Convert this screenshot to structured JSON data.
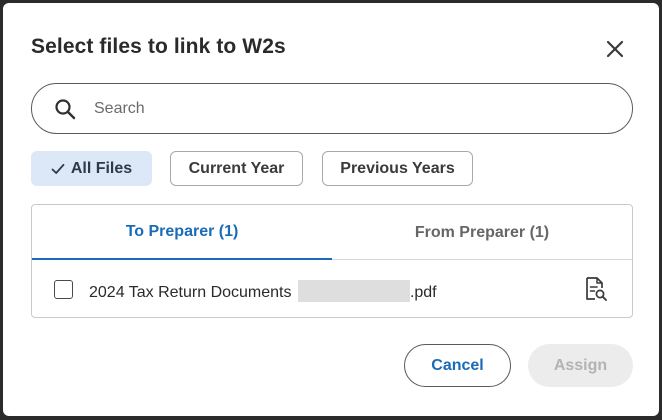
{
  "dialog": {
    "title": "Select files to link to W2s",
    "close_icon": "close-icon"
  },
  "search": {
    "placeholder": "Search",
    "value": "",
    "icon": "search-icon"
  },
  "filters": {
    "all_files": {
      "label": "All Files",
      "selected": true,
      "icon": "checkmark-icon"
    },
    "current_year": {
      "label": "Current Year",
      "selected": false
    },
    "previous_years": {
      "label": "Previous Years",
      "selected": false
    }
  },
  "tabs": {
    "to_preparer": {
      "label": "To Preparer (1)",
      "active": true
    },
    "from_preparer": {
      "label": "From Preparer (1)",
      "active": false
    }
  },
  "files": [
    {
      "name_prefix": "2024 Tax Return Documents",
      "name_suffix": ".pdf",
      "checked": false,
      "preview_icon": "document-preview-icon"
    }
  ],
  "actions": {
    "cancel_label": "Cancel",
    "assign_label": "Assign",
    "assign_enabled": false
  },
  "colors": {
    "accent": "#1a6bb8",
    "filter_active_bg": "#dce7f7",
    "disabled_bg": "#ececec",
    "disabled_text": "#b3b3b3"
  }
}
